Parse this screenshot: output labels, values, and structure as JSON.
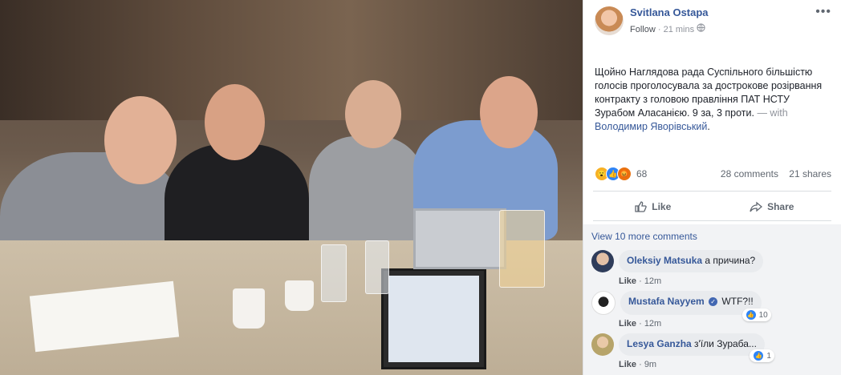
{
  "post": {
    "author": "Svitlana Ostapa",
    "follow": "Follow",
    "time": "21 mins",
    "privacy_icon": "globe-icon",
    "menu_icon": "more-horizontal-icon",
    "text": "Щойно Наглядова рада Суспільного більшістю голосів проголосувала за дострокове розірвання контракту з головою правління ПАТ НСТУ Зурабом Аласанією. 9 за, 3 проти.",
    "with_label": "— with",
    "with_person": "Володимир Яворівський",
    "reaction_count": "68",
    "comments_count": "28 comments",
    "shares_count": "21 shares",
    "like_label": "Like",
    "share_label": "Share"
  },
  "comments": {
    "view_more": "View 10 more comments",
    "items": [
      {
        "author": "Oleksiy Matsuka",
        "text": "а причина?",
        "like": "Like",
        "time": "12m",
        "reactions": ""
      },
      {
        "author": "Mustafa Nayyem",
        "text": "WTF?!!",
        "like": "Like",
        "time": "12m",
        "reactions": "10"
      },
      {
        "author": "Lesya Ganzha",
        "text": "з'їли Зураба...",
        "like": "Like",
        "time": "9m",
        "reactions": "1"
      }
    ]
  },
  "colors": {
    "link": "#365899",
    "meta": "#90949c",
    "like_blue": "#2e84f6",
    "wow_yellow": "#f7b125",
    "angry_orange": "#e9710f"
  }
}
